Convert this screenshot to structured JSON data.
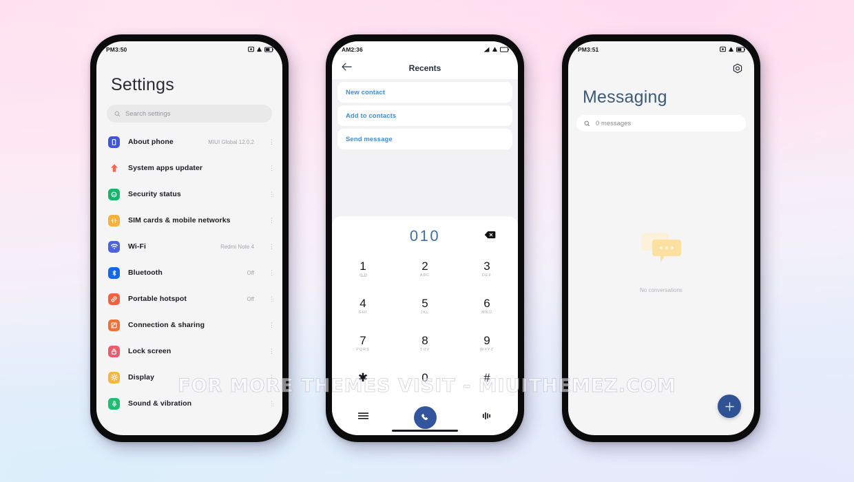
{
  "watermark": "FOR MORE THEMES VISIT - MIUITHEMEZ.COM",
  "background": {
    "top_color": "#ffdff0",
    "bottom_left_color": "#dceefb",
    "bottom_right_color": "#e9ebfb"
  },
  "phone_settings": {
    "status_bar": {
      "time": "PM3:50",
      "icons": [
        "screenshot-icon",
        "cast-icon",
        "battery-icon"
      ]
    },
    "title": "Settings",
    "search": {
      "placeholder": "Search settings",
      "icon": "search-icon"
    },
    "items": [
      {
        "label": "About phone",
        "value": "MIUI Global 12.0.2",
        "icon": "phone-info-icon",
        "color": "#4056d4"
      },
      {
        "label": "System apps updater",
        "value": "",
        "icon": "up-arrow-icon",
        "color": "#ee6a52"
      },
      {
        "label": "Security status",
        "value": "",
        "icon": "shield-icon",
        "color": "#19b36b"
      },
      {
        "label": "SIM cards & mobile networks",
        "value": "",
        "icon": "sim-card-icon",
        "color": "#f5b13d"
      },
      {
        "label": "Wi-Fi",
        "value": "Redmi Note 4",
        "icon": "wifi-icon",
        "color": "#4b63dd"
      },
      {
        "label": "Bluetooth",
        "value": "Off",
        "icon": "bluetooth-icon",
        "color": "#1667e8"
      },
      {
        "label": "Portable hotspot",
        "value": "Off",
        "icon": "hotspot-icon",
        "color": "#f0623c"
      },
      {
        "label": "Connection & sharing",
        "value": "",
        "icon": "sharing-icon",
        "color": "#ef7038"
      },
      {
        "label": "Lock screen",
        "value": "",
        "icon": "lock-icon",
        "color": "#ec5a6b"
      },
      {
        "label": "Display",
        "value": "",
        "icon": "brightness-icon",
        "color": "#f6b53f"
      },
      {
        "label": "Sound & vibration",
        "value": "",
        "icon": "sound-icon",
        "color": "#1dbd72"
      }
    ],
    "row_menu_icon": "more-options-icon"
  },
  "phone_dialer": {
    "status_bar": {
      "time": "AM2:36",
      "icons": [
        "signal-icon",
        "cast-icon",
        "battery-icon"
      ]
    },
    "title": "Recents",
    "back_icon": "back-arrow-icon",
    "actions": [
      {
        "label": "New contact"
      },
      {
        "label": "Add to contacts"
      },
      {
        "label": "Send message"
      }
    ],
    "dialed_number": "010",
    "backspace_icon": "backspace-icon",
    "keys": [
      {
        "digit": "1",
        "sub": ""
      },
      {
        "digit": "2",
        "sub": "ABC"
      },
      {
        "digit": "3",
        "sub": "DEF"
      },
      {
        "digit": "4",
        "sub": "GHI"
      },
      {
        "digit": "5",
        "sub": "JKL"
      },
      {
        "digit": "6",
        "sub": "MNO"
      },
      {
        "digit": "7",
        "sub": "PQRS"
      },
      {
        "digit": "8",
        "sub": "TUV"
      },
      {
        "digit": "9",
        "sub": "WXYZ"
      },
      {
        "digit": "✱",
        "sub": ""
      },
      {
        "digit": "0",
        "sub": ""
      },
      {
        "digit": "#",
        "sub": ""
      }
    ],
    "bottom": {
      "left_icon": "menu-icon",
      "call_icon": "call-icon",
      "right_icon": "keypad-hide-icon",
      "call_button_color": "#33559e"
    }
  },
  "phone_messaging": {
    "status_bar": {
      "time": "PM3:51",
      "icons": [
        "screenshot-icon",
        "cast-icon",
        "battery-icon"
      ]
    },
    "settings_icon": "gear-icon",
    "title": "Messaging",
    "search": {
      "placeholder": "0 messages",
      "icon": "search-icon"
    },
    "empty_state": {
      "icon": "chat-bubbles-icon",
      "text": "No conversations",
      "icon_color": "#fbe4a6"
    },
    "fab": {
      "icon": "plus-icon",
      "color": "#2f5294"
    }
  }
}
